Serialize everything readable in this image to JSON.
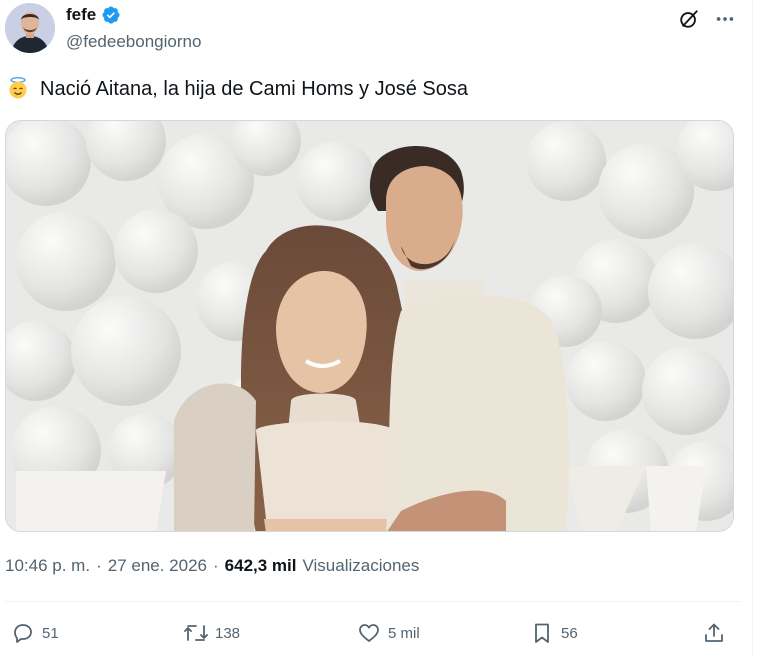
{
  "author": {
    "display_name": "fefe",
    "handle": "@fedeebongiorno",
    "verified": true,
    "accent_color": "#1d9bf0"
  },
  "tweet": {
    "emoji_icon": "angel-face-emoji",
    "text": "Nació Aitana, la hija de Cami Homs y José Sosa"
  },
  "meta": {
    "time": "10:46 p. m.",
    "date": "27 ene. 2026",
    "separator": "·",
    "views_count": "642,3 mil",
    "views_label": "Visualizaciones"
  },
  "actions": {
    "replies": "51",
    "reposts": "138",
    "likes": "5 mil",
    "bookmarks": "56"
  },
  "colors": {
    "text_primary": "#0f1419",
    "text_secondary": "#536471",
    "border": "#cfd9de"
  }
}
